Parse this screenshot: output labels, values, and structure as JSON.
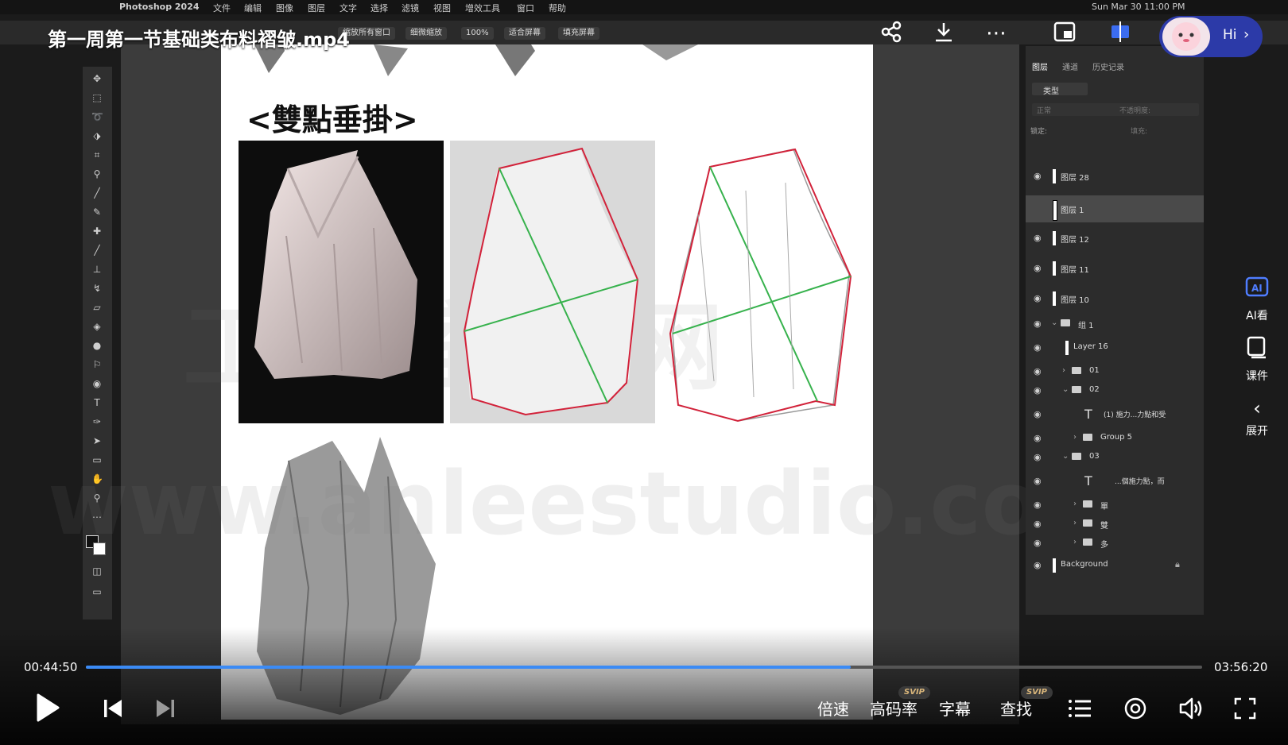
{
  "player": {
    "title": "第一周第一节基础类布料褶皱.mp4",
    "current_time": "00:44:50",
    "total_time": "03:56:20",
    "progress": 0.685,
    "accent_color": "#3b8bf5",
    "hi_label": "Hi",
    "side_items": [
      {
        "label": "AI看",
        "icon": "ai-watch-icon"
      },
      {
        "label": "课件",
        "icon": "courseware-icon"
      },
      {
        "label": "展开",
        "icon": "chevron-left-icon"
      }
    ],
    "controls": {
      "speed": "倍速",
      "bitrate": "高码率",
      "subtitle": "字幕",
      "search": "查找",
      "svip_badge": "SVIP"
    }
  },
  "mac_menubar": {
    "app": "Photoshop 2024",
    "menus": [
      "文件",
      "编辑",
      "图像",
      "图层",
      "文字",
      "选择",
      "滤镜",
      "视图",
      "增效工具",
      "窗口",
      "帮助"
    ],
    "clock": "Sun Mar 30  11:00 PM"
  },
  "ps_options": {
    "items": [
      "缩放所有窗口",
      "细微缩放",
      "100%",
      "适合屏幕",
      "填充屏幕"
    ]
  },
  "document": {
    "heading": "<雙點垂掛>",
    "watermark_top": "工作室官网",
    "watermark_bottom": "www.anleestudio.com"
  },
  "layers_panel": {
    "tabs": [
      "图层",
      "通道",
      "历史记录"
    ],
    "filter_label": "类型",
    "blend_mode": "正常",
    "opacity_label": "不透明度:",
    "lock_label": "锁定:",
    "fill_label": "填充:",
    "layers": [
      {
        "name": "图层 28",
        "type": "layer",
        "indent": 0
      },
      {
        "name": "图层 1",
        "type": "layer",
        "indent": 0,
        "selected": true
      },
      {
        "name": "图层 12",
        "type": "layer",
        "indent": 0
      },
      {
        "name": "图层 11",
        "type": "layer",
        "indent": 0
      },
      {
        "name": "图层 10",
        "type": "layer",
        "indent": 0
      },
      {
        "name": "组 1",
        "type": "group",
        "indent": 0,
        "open": true
      },
      {
        "name": "Layer 16",
        "type": "layer",
        "indent": 1
      },
      {
        "name": "01",
        "type": "group",
        "indent": 1
      },
      {
        "name": "02",
        "type": "group",
        "indent": 1,
        "open": true
      },
      {
        "name": "(1) 施力...力點和受",
        "type": "text",
        "indent": 2
      },
      {
        "name": "Group 5",
        "type": "group",
        "indent": 2
      },
      {
        "name": "03",
        "type": "group",
        "indent": 1,
        "open": true
      },
      {
        "name": "...個施力點，而",
        "type": "text",
        "indent": 2
      },
      {
        "name": "單",
        "type": "group",
        "indent": 2
      },
      {
        "name": "雙",
        "type": "group",
        "indent": 2
      },
      {
        "name": "多",
        "type": "group",
        "indent": 2
      },
      {
        "name": "Background",
        "type": "background",
        "indent": 0
      }
    ]
  }
}
